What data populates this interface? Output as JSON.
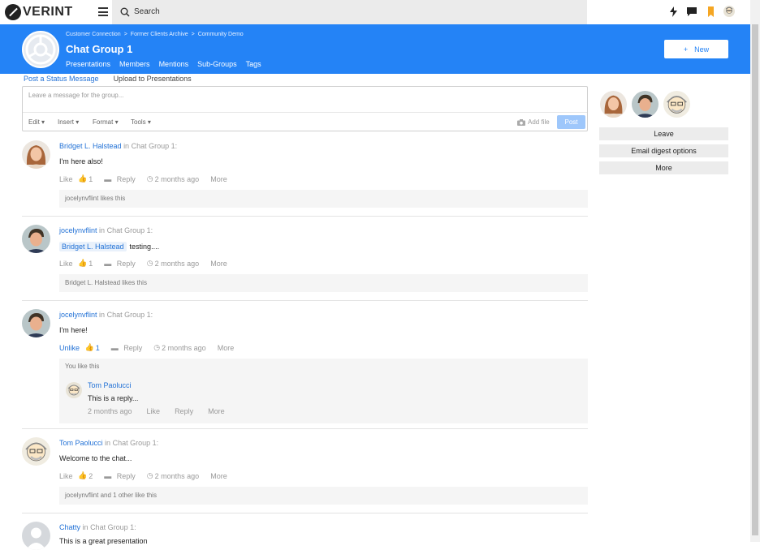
{
  "topbar": {
    "logo_text": "VERINT",
    "search_placeholder": "Search",
    "icons": [
      "lightning-icon",
      "chat-bubble-icon",
      "bookmark-icon",
      "user-avatar"
    ],
    "colors": {
      "bookmark": "#f5a623",
      "brand": "#2483f6"
    }
  },
  "hero": {
    "breadcrumbs": [
      "Customer Connection",
      ">",
      "Former Clients Archive",
      ">",
      "Community Demo"
    ],
    "title": "Chat Group 1",
    "nav": [
      "Presentations",
      "Members",
      "Mentions",
      "Sub-Groups",
      "Tags"
    ],
    "new_button_icon": "+",
    "new_button_label": "New"
  },
  "composer": {
    "tabs": [
      "Post a Status Message",
      "Upload to Presentations"
    ],
    "placeholder": "Leave a message for the group...",
    "tools": [
      "Edit",
      "Insert",
      "Format",
      "Tools"
    ],
    "add_file": "Add file",
    "post": "Post"
  },
  "feed": [
    {
      "author": "Bridget L. Halstead",
      "in": "in",
      "group": "Chat Group 1:",
      "body": "I'm here also!",
      "like_label": "Like",
      "like_count": "1",
      "reply": "Reply",
      "time": "2 months ago",
      "more": "More",
      "likes_text": "jocelynvflint likes this"
    },
    {
      "author": "jocelynvflint",
      "in": "in",
      "group": "Chat Group 1:",
      "mention": "Bridget L. Halstead",
      "body": "testing....",
      "like_label": "Like",
      "like_count": "1",
      "reply": "Reply",
      "time": "2 months ago",
      "more": "More",
      "likes_text": "Bridget L. Halstead likes this"
    },
    {
      "author": "jocelynvflint",
      "in": "in",
      "group": "Chat Group 1:",
      "body": "I'm here!",
      "like_label": "Unlike",
      "like_count": "1",
      "reply": "Reply",
      "time": "2 months ago",
      "more": "More",
      "likes_text": "You like this",
      "reply_item": {
        "author": "Tom Paolucci",
        "body": "This is a reply...",
        "time": "2 months ago",
        "like": "Like",
        "reply": "Reply",
        "more": "More"
      }
    },
    {
      "author": "Tom Paolucci",
      "in": "in",
      "group": "Chat Group 1:",
      "body": "Welcome to the chat...",
      "like_label": "Like",
      "like_count": "2",
      "reply": "Reply",
      "time": "2 months ago",
      "more": "More",
      "likes_text": "jocelynvflint and 1 other like this"
    },
    {
      "author": "Chatty",
      "in": "in",
      "group": "Chat Group 1:",
      "body": "This is a great presentation"
    }
  ],
  "sidebar": {
    "leave": "Leave",
    "email_digest": "Email digest options",
    "more": "More"
  }
}
